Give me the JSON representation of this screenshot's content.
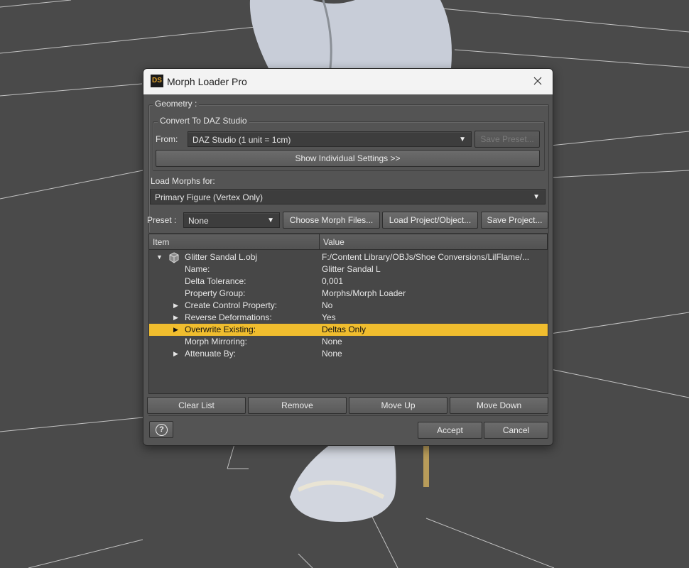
{
  "dialog": {
    "title": "Morph Loader Pro",
    "logo_text": "DS"
  },
  "geometry": {
    "group_label": "Geometry :",
    "convert_label": "Convert To DAZ Studio",
    "from_label": "From:",
    "from_value": "DAZ Studio (1 unit = 1cm)",
    "save_preset_label": "Save Preset...",
    "show_settings_label": "Show Individual Settings >>"
  },
  "load_morphs": {
    "label": "Load Morphs for:",
    "value": "Primary Figure (Vertex Only)"
  },
  "preset_bar": {
    "preset_label": "Preset :",
    "preset_value": "None",
    "choose_files_label": "Choose Morph Files...",
    "load_project_label": "Load Project/Object...",
    "save_project_label": "Save Project..."
  },
  "tree": {
    "columns": [
      "Item",
      "Value"
    ],
    "root": {
      "item": "Glitter Sandal L.obj",
      "value": "F:/Content Library/OBJs/Shoe Conversions/LilFlame/..."
    },
    "rows": [
      {
        "item": "Name:",
        "value": "Glitter Sandal L",
        "expandable": false
      },
      {
        "item": "Delta Tolerance:",
        "value": "0,001",
        "expandable": false
      },
      {
        "item": "Property Group:",
        "value": "Morphs/Morph Loader",
        "expandable": false
      },
      {
        "item": "Create Control Property:",
        "value": "No",
        "expandable": true
      },
      {
        "item": "Reverse Deformations:",
        "value": "Yes",
        "expandable": true
      },
      {
        "item": "Overwrite Existing:",
        "value": "Deltas Only",
        "expandable": true,
        "selected": true
      },
      {
        "item": "Morph Mirroring:",
        "value": "None",
        "expandable": false
      },
      {
        "item": "Attenuate By:",
        "value": "None",
        "expandable": true
      }
    ]
  },
  "list_buttons": {
    "clear": "Clear List",
    "remove": "Remove",
    "move_up": "Move Up",
    "move_down": "Move Down"
  },
  "footer": {
    "help_glyph": "?",
    "accept": "Accept",
    "cancel": "Cancel"
  },
  "colors": {
    "selection": "#f0bd2e",
    "dialog_bg": "#545454",
    "viewport_bg": "#4a4a4a"
  }
}
